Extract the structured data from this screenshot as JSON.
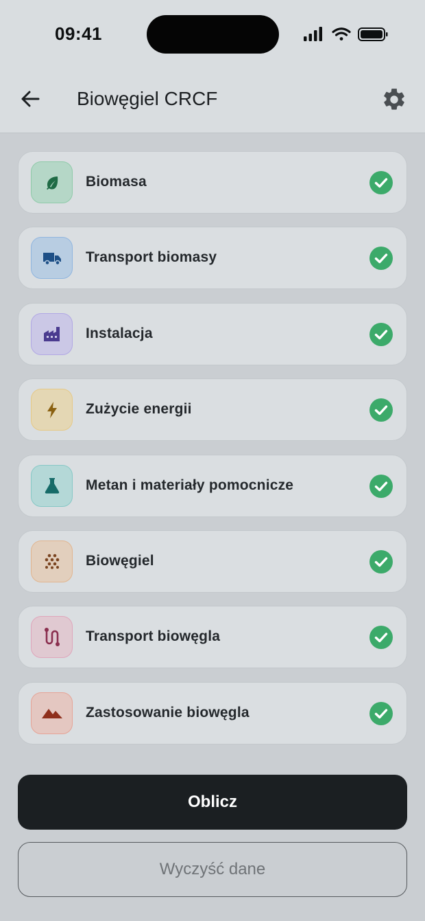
{
  "status_bar": {
    "time": "09:41",
    "icons": [
      "signal-icon",
      "wifi-icon",
      "battery-icon"
    ]
  },
  "header": {
    "title": "Biowęgiel CRCF",
    "back_icon": "arrow-left-icon",
    "settings_icon": "gear-icon"
  },
  "sections": [
    {
      "label": "Biomasa",
      "icon": "leaf-icon",
      "tile_bg": "#b5d7c7",
      "tile_border": "#8fcaa9",
      "icon_color": "#1f6b45",
      "completed": true
    },
    {
      "label": "Transport biomasy",
      "icon": "truck-icon",
      "tile_bg": "#b8cde2",
      "tile_border": "#8fb5df",
      "icon_color": "#1d4f86",
      "completed": true
    },
    {
      "label": "Instalacja",
      "icon": "factory-icon",
      "tile_bg": "#cbc8e6",
      "tile_border": "#b1a7e4",
      "icon_color": "#4a3b8f",
      "completed": true
    },
    {
      "label": "Zużycie energii",
      "icon": "lightning-icon",
      "tile_bg": "#e4d7b4",
      "tile_border": "#e6c986",
      "icon_color": "#8a6010",
      "completed": true
    },
    {
      "label": "Metan i materiały pomocnicze",
      "icon": "flask-icon",
      "tile_bg": "#b4d8d7",
      "tile_border": "#86c8c6",
      "icon_color": "#166b68",
      "completed": true
    },
    {
      "label": "Biowęgiel",
      "icon": "granules-icon",
      "tile_bg": "#e2cfbd",
      "tile_border": "#e1b58f",
      "icon_color": "#7a4420",
      "completed": true
    },
    {
      "label": "Transport biowęgla",
      "icon": "route-icon",
      "tile_bg": "#e0c9d1",
      "tile_border": "#dfa5bb",
      "icon_color": "#8a2f4f",
      "completed": true
    },
    {
      "label": "Zastosowanie biowęgla",
      "icon": "mountains-icon",
      "tile_bg": "#e4c7c1",
      "tile_border": "#e6a396",
      "icon_color": "#8e2f1c",
      "completed": true
    }
  ],
  "check_color": "#3caa6a",
  "actions": {
    "calculate_label": "Oblicz",
    "clear_label": "Wyczyść dane"
  }
}
